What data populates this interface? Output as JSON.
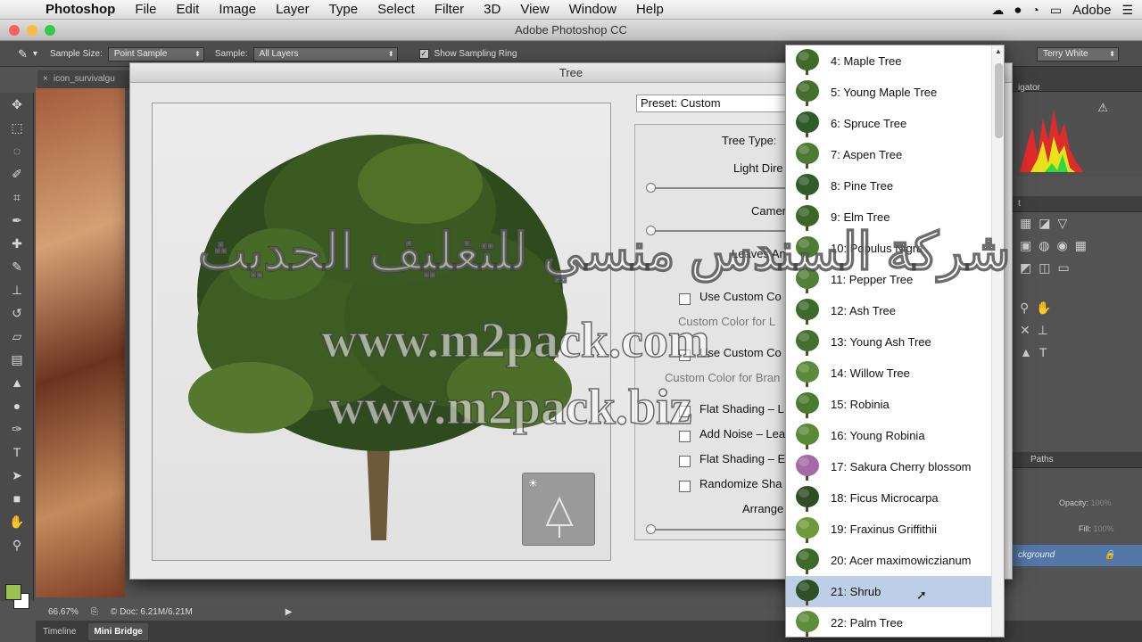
{
  "menubar": {
    "app_name": "Photoshop",
    "items": [
      "File",
      "Edit",
      "Image",
      "Layer",
      "Type",
      "Select",
      "Filter",
      "3D",
      "View",
      "Window",
      "Help"
    ],
    "right_label": "Adobe"
  },
  "window": {
    "title": "Adobe Photoshop CC"
  },
  "options": {
    "sample_size_label": "Sample Size:",
    "sample_size_value": "Point Sample",
    "sample_label": "Sample:",
    "sample_value": "All Layers",
    "show_ring_label": "Show Sampling Ring",
    "show_ring_checked": true,
    "workspace": "Terry White"
  },
  "document": {
    "tab_name": "icon_survivalgu"
  },
  "status": {
    "zoom": "66.67%",
    "doc_size": "© Doc: 6.21M/6.21M"
  },
  "bottom_tabs": [
    "Timeline",
    "Mini Bridge"
  ],
  "right_panel": {
    "navigator_tab": "igator",
    "paths_tab": "Paths",
    "opacity_label": "Opacity:",
    "opacity_value": "100%",
    "fill_label": "Fill:",
    "fill_value": "100%",
    "layer_name": "ckground",
    "panel_letter": "t"
  },
  "dialog": {
    "title": "Tree",
    "preset": "Preset: Custom",
    "labels": {
      "tree_type": "Tree Type:",
      "light_direction": "Light Dire",
      "camera": "Camer",
      "leaves_amount": "Leaves An",
      "use_custom_color_leaves": "Use Custom Co",
      "custom_color_leaves": "Custom Color for L",
      "use_custom_color_branches": "Use Custom Co",
      "custom_color_branches": "Custom Color for Bran",
      "flat_shading_leaves": "Flat Shading – L",
      "add_noise": "Add Noise – Lea",
      "flat_shading_branches": "Flat Shading – E",
      "randomize_shapes": "Randomize Sha",
      "arrangement": "Arrange"
    }
  },
  "tree_list": {
    "items": [
      {
        "label": "4: Maple Tree",
        "icon": "maple-tree-icon",
        "color": "#3e6b2a"
      },
      {
        "label": "5: Young Maple Tree",
        "icon": "young-maple-tree-icon",
        "color": "#456f2c"
      },
      {
        "label": "6: Spruce Tree",
        "icon": "spruce-tree-icon",
        "color": "#2f5a29"
      },
      {
        "label": "7: Aspen Tree",
        "icon": "aspen-tree-icon",
        "color": "#4d7a32"
      },
      {
        "label": "8: Pine Tree",
        "icon": "pine-tree-icon",
        "color": "#315c2a"
      },
      {
        "label": "9: Elm Tree",
        "icon": "elm-tree-icon",
        "color": "#3a6628"
      },
      {
        "label": "10: Populus Nigra",
        "icon": "populus-nigra-icon",
        "color": "#4f7c34"
      },
      {
        "label": "11: Pepper Tree",
        "icon": "pepper-tree-icon",
        "color": "#52803a"
      },
      {
        "label": "12: Ash Tree",
        "icon": "ash-tree-icon",
        "color": "#3d6a2c"
      },
      {
        "label": "13: Young Ash Tree",
        "icon": "young-ash-tree-icon",
        "color": "#42702f"
      },
      {
        "label": "14: Willow Tree",
        "icon": "willow-tree-icon",
        "color": "#5c8a3a"
      },
      {
        "label": "15: Robinia",
        "icon": "robinia-icon",
        "color": "#4a7a30"
      },
      {
        "label": "16: Young Robinia",
        "icon": "young-robinia-icon",
        "color": "#5a8a36"
      },
      {
        "label": "17: Sakura Cherry blossom",
        "icon": "sakura-cherry-icon",
        "color": "#a46aa8"
      },
      {
        "label": "18: Ficus Microcarpa",
        "icon": "ficus-microcarpa-icon",
        "color": "#2e4e24"
      },
      {
        "label": "19: Fraxinus Griffithii",
        "icon": "fraxinus-griffithii-icon",
        "color": "#6f9a3a"
      },
      {
        "label": "20: Acer maximowiczianum",
        "icon": "acer-maximowiczianum-icon",
        "color": "#3b6a2a"
      },
      {
        "label": "21: Shrub",
        "icon": "shrub-icon",
        "color": "#2f4f26",
        "selected": true
      },
      {
        "label": "22: Palm Tree",
        "icon": "palm-tree-icon",
        "color": "#5e8d3c"
      }
    ]
  },
  "watermark": {
    "arabic": "شركة السندس منسي للتغليف الحديث",
    "url1": "www.m2pack.com",
    "url2": "www.m2pack.biz"
  }
}
